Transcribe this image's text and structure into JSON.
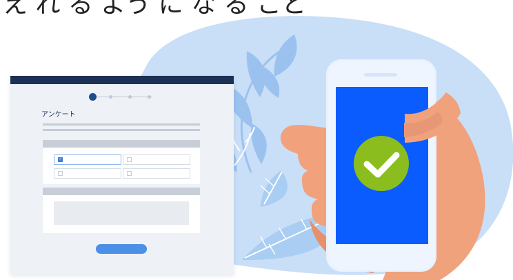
{
  "headline": "え れ る よう に な る こと",
  "form": {
    "title": "アンケート",
    "progress": {
      "current_step": 1,
      "total_steps": 4
    },
    "options": [
      {
        "selected": true
      },
      {
        "selected": false
      },
      {
        "selected": false
      },
      {
        "selected": false
      }
    ]
  },
  "phone": {
    "screen_status_icon": "check-circle-icon",
    "hand_icon": "hand-holding-phone-icon"
  },
  "colors": {
    "blob": "#c9def7",
    "form_header": "#1d3155",
    "form_background": "#eef1f5",
    "submit_button": "#4b8fe7",
    "phone_screen": "#0b5cff",
    "check_circle": "#8bbd1e",
    "hand": "#ef9f7a",
    "leaves": "#9ac3f0"
  }
}
